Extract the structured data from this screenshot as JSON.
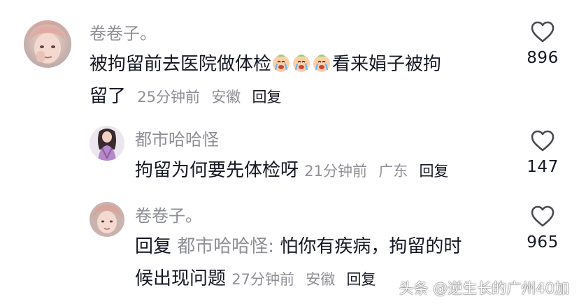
{
  "comments": [
    {
      "username": "卷卷子。",
      "text_before_emoji": "被拘留前去医院做体检",
      "emoji": [
        "crying-emoji",
        "crying-emoji",
        "crying-emoji"
      ],
      "text_after_emoji": "看来娟子被拘",
      "text_line2": "留了",
      "time": "25分钟前",
      "location": "安徽",
      "reply_label": "回复",
      "likes": "896"
    },
    {
      "username": "都市哈哈怪",
      "text": "拘留为何要先体检呀",
      "time": "21分钟前",
      "location": "广东",
      "reply_label": "回复",
      "likes": "147"
    },
    {
      "username": "卷卷子。",
      "reply_prefix": "回复",
      "reply_to": "都市哈哈怪:",
      "text_line1": "怕你有疾病，拘留的时",
      "text_line2": "候出现问题",
      "time": "27分钟前",
      "location": "安徽",
      "reply_label": "回复",
      "likes": "965"
    }
  ],
  "watermark": "头条 @逆生长的广州40加",
  "colors": {
    "primary_text": "#161823",
    "secondary_text": "#8e8f96",
    "background": "#ffffff"
  },
  "icons": {
    "like": "heart-outline-icon"
  }
}
